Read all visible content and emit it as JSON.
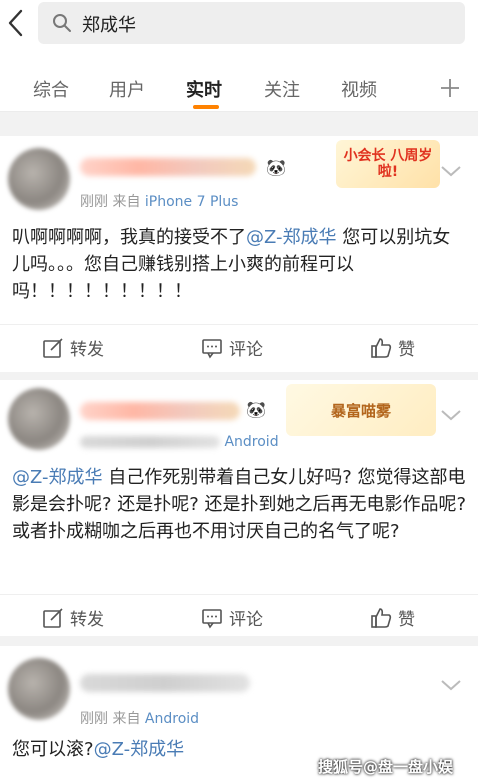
{
  "search": {
    "query": "郑成华"
  },
  "tabs": [
    {
      "label": "综合"
    },
    {
      "label": "用户"
    },
    {
      "label": "实时"
    },
    {
      "label": "关注"
    },
    {
      "label": "视频"
    }
  ],
  "posts": [
    {
      "meta_prefix": "刚刚  来自",
      "source": "iPhone 7 Plus",
      "badge": "小会长 八周岁啦!",
      "text_before": "叭啊啊啊啊，我真的接受不了",
      "mention": "@Z-郑成华",
      "text_after": " 您可以别坑女儿吗。。。您自己赚钱别搭上小爽的前程可以吗！！！！！！！！！",
      "actions": {
        "repost": "转发",
        "comment": "评论",
        "like": "赞"
      }
    },
    {
      "meta_prefix": "",
      "source": "Android",
      "badge": "暴富喵雾",
      "text_before": "",
      "mention": "@Z-郑成华",
      "text_after": " 自己作死别带着自己女儿好吗? 您觉得这部电影是会扑呢? 还是扑呢? 还是扑到她之后再无电影作品呢? 或者扑成糊咖之后再也不用讨厌自己的名气了呢?",
      "actions": {
        "repost": "转发",
        "comment": "评论",
        "like": "赞"
      }
    },
    {
      "meta_prefix": "刚刚  来自",
      "source": "Android",
      "text_before": "您可以滚?",
      "mention": "@Z-郑成华",
      "text_after": ""
    }
  ],
  "watermark": "搜狐号@盘一盘小娱",
  "colors": {
    "accent": "#ff8200",
    "link": "#4a7cb5"
  }
}
